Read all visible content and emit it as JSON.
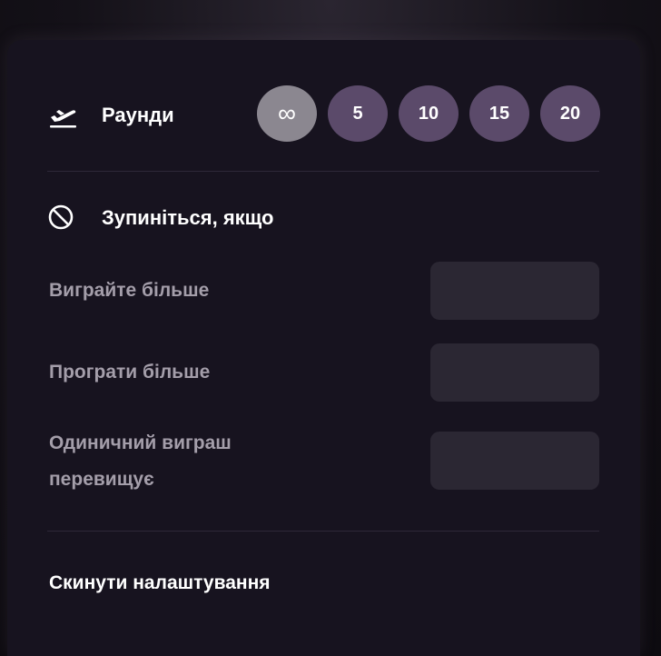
{
  "rounds": {
    "label": "Раунди",
    "icon": "plane-departure-icon",
    "options": [
      "∞",
      "5",
      "10",
      "15",
      "20"
    ],
    "selected": "∞"
  },
  "stop_if": {
    "label": "Зупиніться, якщо",
    "icon": "prohibit-icon",
    "fields": {
      "win_more": {
        "label": "Виграйте більше",
        "value": ""
      },
      "lose_more": {
        "label": "Програти більше",
        "value": ""
      },
      "single_win_line1": "Одиничний виграш",
      "single_win_line2": "перевищує",
      "single_win_value": ""
    }
  },
  "reset": {
    "label": "Скинути налаштування"
  },
  "colors": {
    "panel_bg": "#17131f",
    "round_btn": "#5b4a6a",
    "round_btn_active": "#8b8790",
    "input_bg": "#2b2733",
    "muted_text": "#a49eaa"
  }
}
